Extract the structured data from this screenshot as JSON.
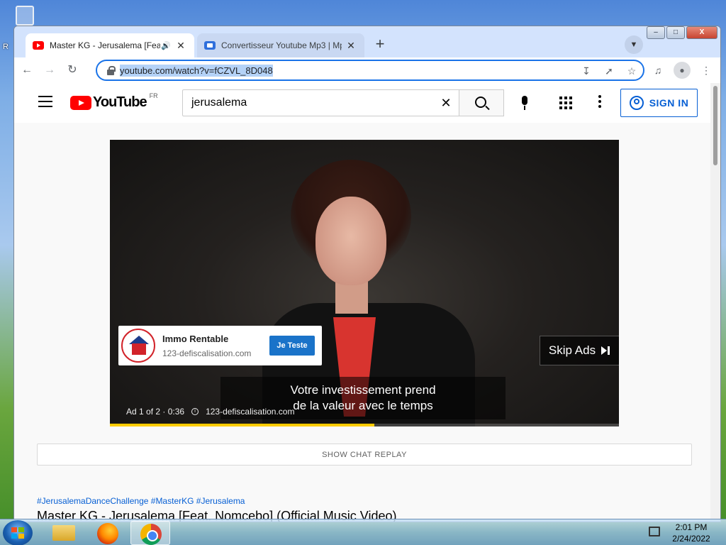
{
  "desktop": {
    "partial_letter": "R"
  },
  "browser": {
    "tabs": [
      {
        "title": "Master KG - Jerusalema [Feat",
        "active": true,
        "icon": "youtube-icon",
        "audio": true
      },
      {
        "title": "Convertisseur Youtube Mp3 | Mp",
        "active": false,
        "icon": "converter-icon"
      }
    ],
    "new_tab_label": "+",
    "address": {
      "url": "youtube.com/watch?v=fCZVL_8D048"
    },
    "window_controls": {
      "minimize": "‒",
      "maximize": "□",
      "close": "X"
    }
  },
  "youtube": {
    "logo_text": "YouTube",
    "region": "FR",
    "search": {
      "query": "jerusalema"
    },
    "sign_in_label": "SIGN IN",
    "ad": {
      "advertiser_name": "Immo Rentable",
      "advertiser_domain": "123-defiscalisation.com",
      "cta_label": "Je Teste",
      "skip_label": "Skip Ads",
      "caption_line1": "Votre investissement prend",
      "caption_line2": "de la valeur avec le temps",
      "ad_counter": "Ad 1 of 2 · 0:36",
      "ad_link": "123-defiscalisation.com",
      "progress": 0.52
    },
    "chat_replay_label": "SHOW CHAT REPLAY",
    "hashtags": "#JerusalemaDanceChallenge #MasterKG #Jerusalema",
    "video_title": "Master KG - Jerusalema [Feat. Nomcebo] (Official Music Video)"
  },
  "taskbar": {
    "time": "2:01 PM",
    "date": "2/24/2022",
    "pinned": [
      "folder-icon",
      "firefox-icon",
      "chrome-icon"
    ]
  }
}
